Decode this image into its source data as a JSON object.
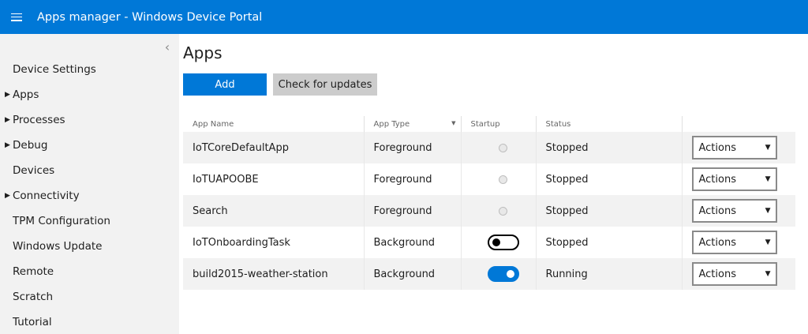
{
  "header": {
    "title": "Apps manager - Windows Device Portal"
  },
  "sidebar": {
    "items": [
      {
        "label": "Device Settings",
        "expandable": false
      },
      {
        "label": "Apps",
        "expandable": true
      },
      {
        "label": "Processes",
        "expandable": true
      },
      {
        "label": "Debug",
        "expandable": true
      },
      {
        "label": "Devices",
        "expandable": false
      },
      {
        "label": "Connectivity",
        "expandable": true
      },
      {
        "label": "TPM Configuration",
        "expandable": false
      },
      {
        "label": "Windows Update",
        "expandable": false
      },
      {
        "label": "Remote",
        "expandable": false
      },
      {
        "label": "Scratch",
        "expandable": false
      },
      {
        "label": "Tutorial",
        "expandable": false
      }
    ]
  },
  "main": {
    "title": "Apps",
    "add_label": "Add",
    "check_updates_label": "Check for updates",
    "table": {
      "headers": {
        "name": "App Name",
        "type": "App Type",
        "startup": "Startup",
        "status": "Status"
      },
      "rows": [
        {
          "name": "IoTCoreDefaultApp",
          "type": "Foreground",
          "startup": "radio",
          "status": "Stopped",
          "action": "Actions"
        },
        {
          "name": "IoTUAPOOBE",
          "type": "Foreground",
          "startup": "radio",
          "status": "Stopped",
          "action": "Actions"
        },
        {
          "name": "Search",
          "type": "Foreground",
          "startup": "radio",
          "status": "Stopped",
          "action": "Actions"
        },
        {
          "name": "IoTOnboardingTask",
          "type": "Background",
          "startup": "toggle-off",
          "status": "Stopped",
          "action": "Actions"
        },
        {
          "name": "build2015-weather-station",
          "type": "Background",
          "startup": "toggle-on",
          "status": "Running",
          "action": "Actions"
        }
      ]
    }
  },
  "colors": {
    "accent": "#0078d7",
    "sidebar_bg": "#f2f2f2",
    "secondary_button": "#cccccc"
  },
  "icons": {
    "menu": "hamburger-icon",
    "collapse": "chevron-left-icon",
    "expand": "triangle-right-icon",
    "dropdown": "triangle-down-icon"
  }
}
